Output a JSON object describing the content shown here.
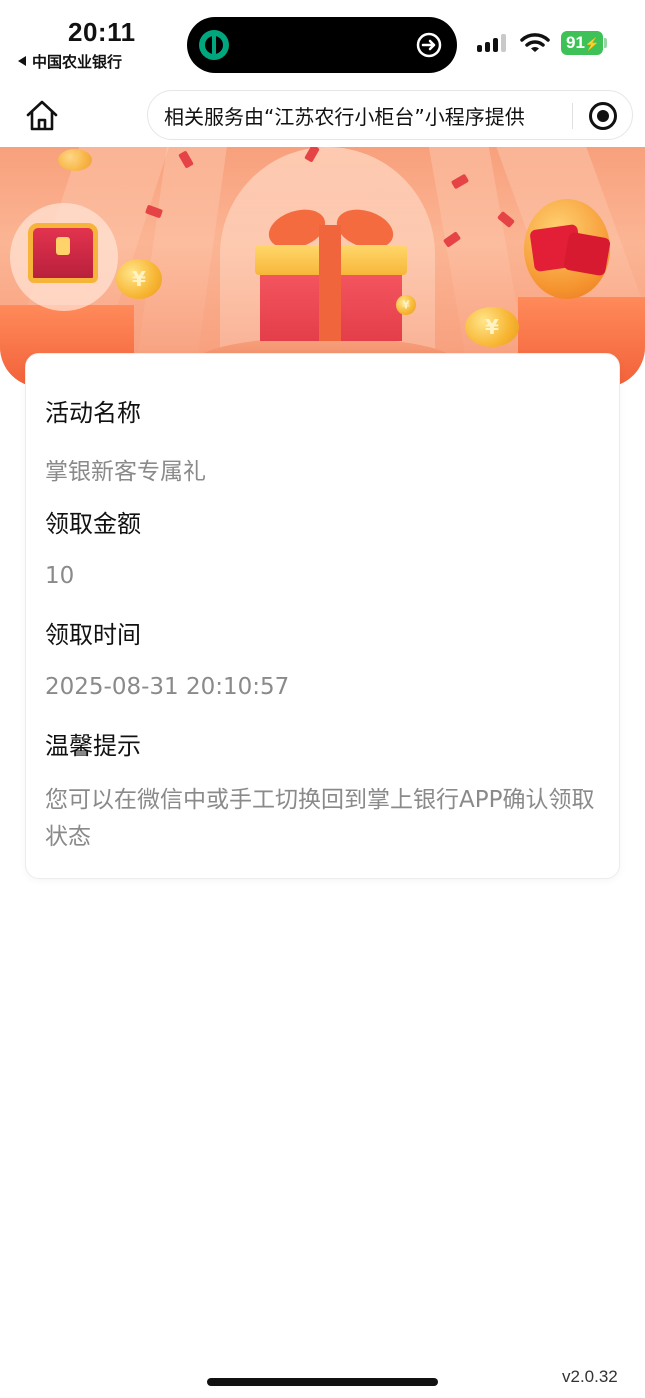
{
  "status_bar": {
    "time": "20:11",
    "back_app": "中国农业银行",
    "battery": "91",
    "icons": [
      "abc-bank-logo-icon",
      "share-icon",
      "signal-icon",
      "wifi-icon",
      "battery-icon"
    ]
  },
  "nav": {
    "home_icon": "home-icon",
    "capsule_text": "相关服务由“江苏农行小柜台”小程序提供",
    "target_icon": "record-target-icon"
  },
  "card": {
    "fields": [
      {
        "label": "活动名称",
        "value": "掌银新客专属礼"
      },
      {
        "label": "领取金额",
        "value": "10"
      },
      {
        "label": "领取时间",
        "value": "2025-08-31 20:10:57"
      },
      {
        "label": "温馨提示",
        "value": "您可以在微信中或手工切换回到掌上银行APP确认领取状态"
      }
    ]
  },
  "footer": {
    "version": "v2.0.32"
  },
  "colors": {
    "banner_orange": "#f8a07c",
    "label_text": "#111111",
    "value_text": "#8a8a8a",
    "battery_green": "#3ec258"
  }
}
